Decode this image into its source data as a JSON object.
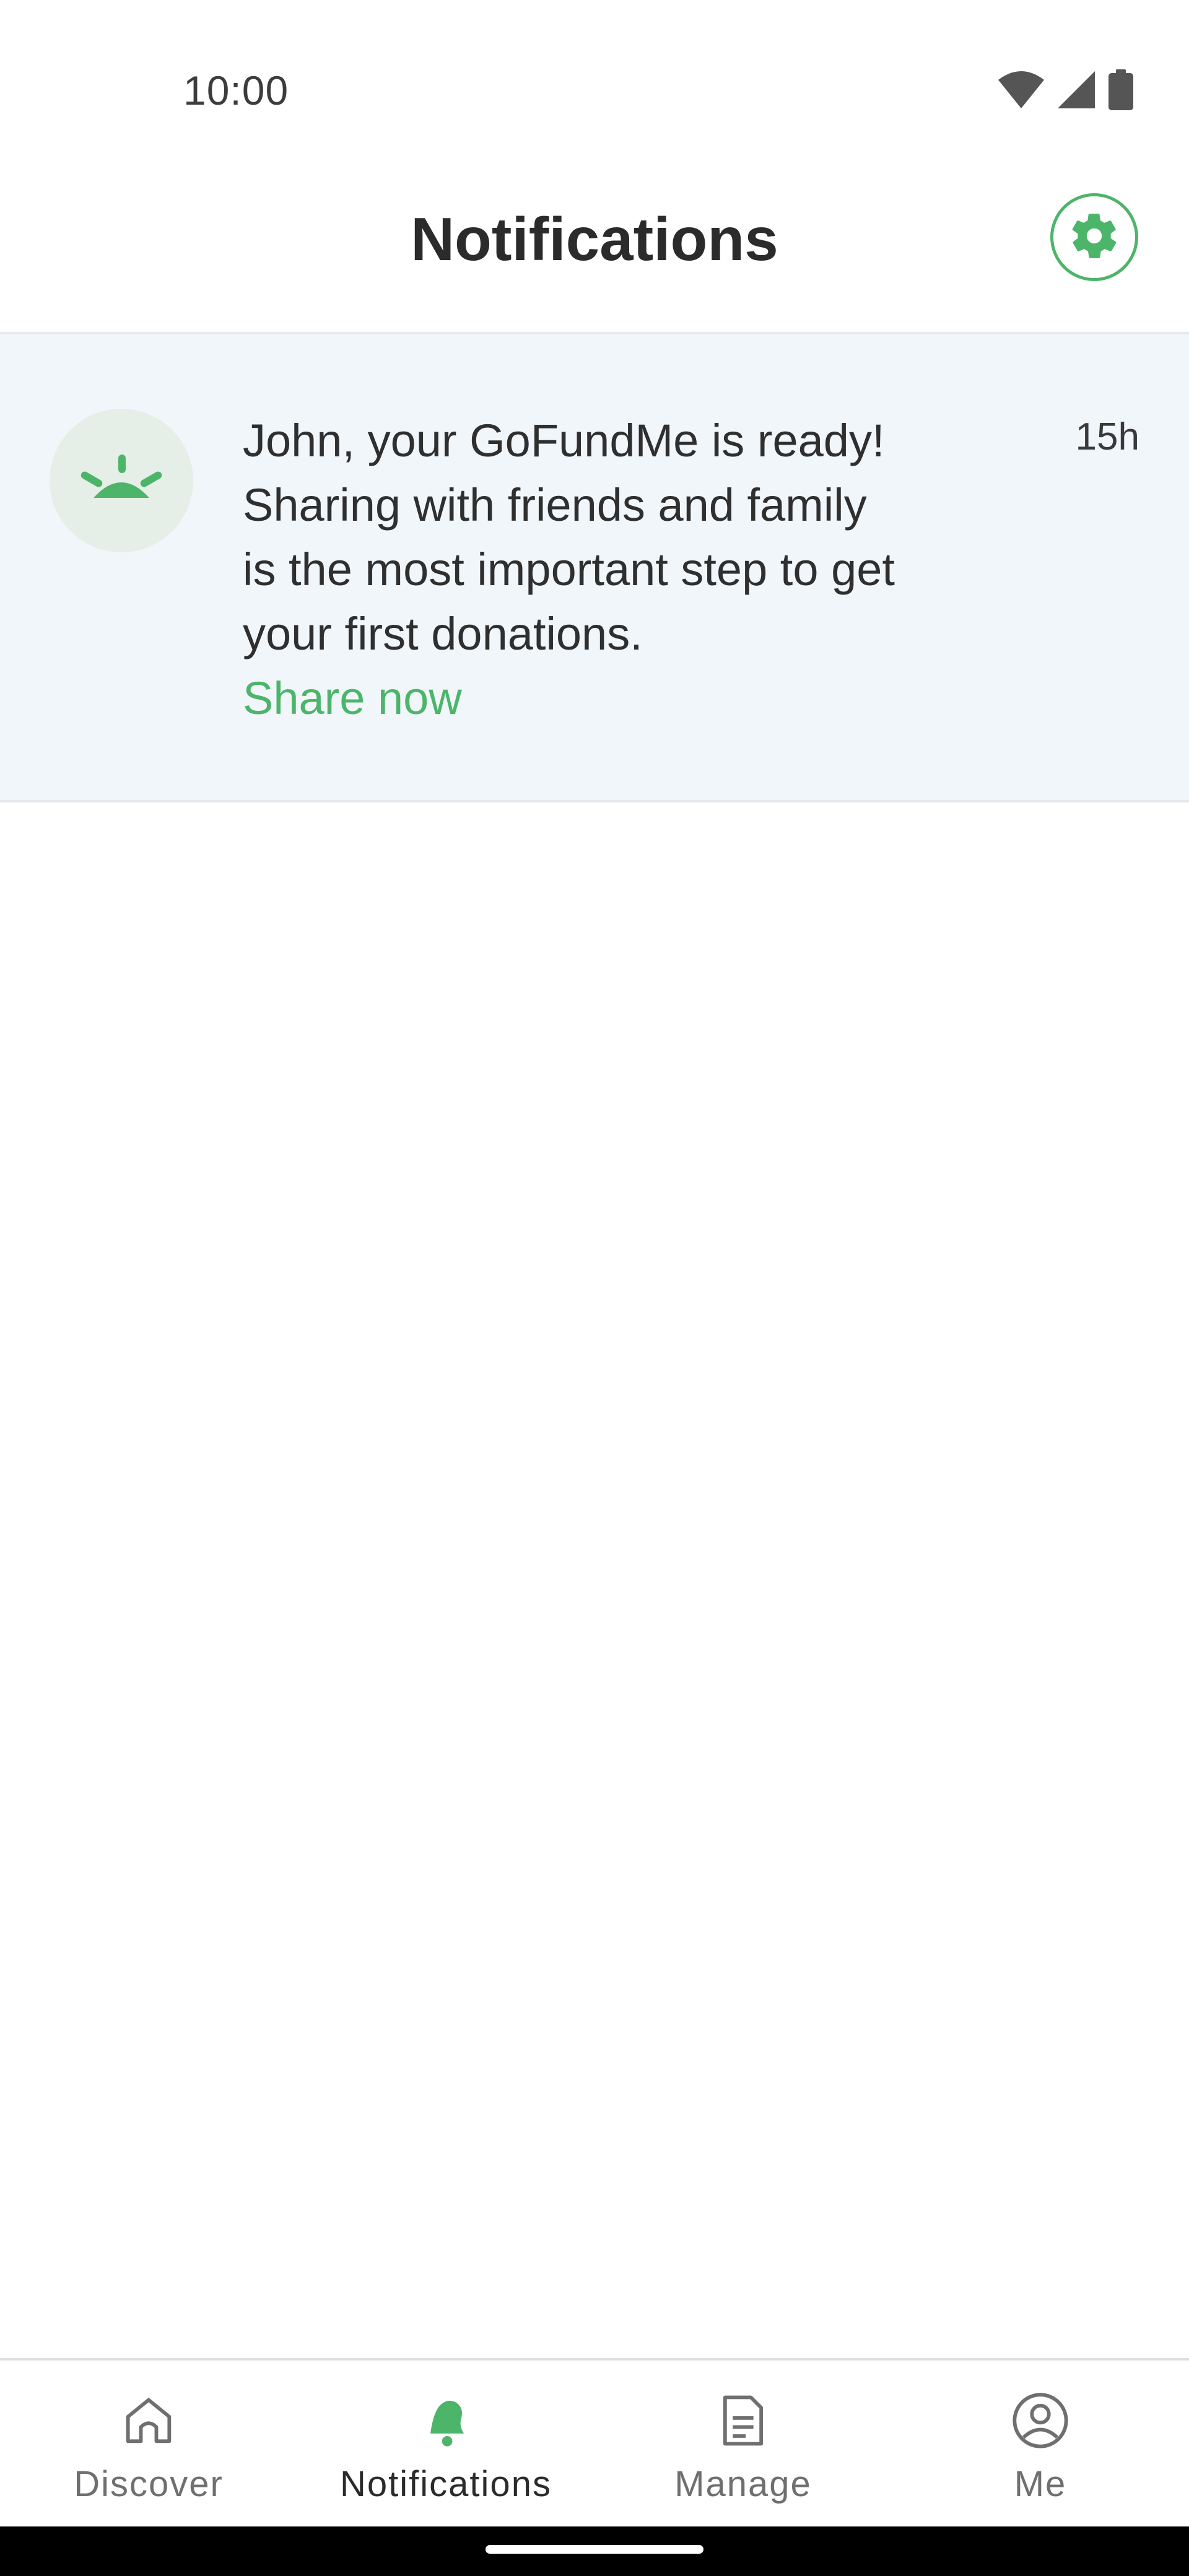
{
  "status_bar": {
    "time": "10:00",
    "icons": [
      "wifi-icon",
      "cellular-signal-icon",
      "battery-icon"
    ]
  },
  "header": {
    "title": "Notifications",
    "settings_icon": "gear-icon"
  },
  "notification": {
    "icon": "gofundme-sunrise-icon",
    "lines": [
      "John, your GoFundMe is ready!",
      "Sharing with friends and family",
      "is the most important step to get",
      "your first donations."
    ],
    "link_label": "Share now",
    "time": "15h"
  },
  "bottom_nav": {
    "items": [
      {
        "label": "Discover",
        "icon": "home-icon",
        "active": false
      },
      {
        "label": "Notifications",
        "icon": "bell-icon",
        "active": true
      },
      {
        "label": "Manage",
        "icon": "document-icon",
        "active": false
      },
      {
        "label": "Me",
        "icon": "profile-icon",
        "active": false
      }
    ]
  },
  "colors": {
    "accent": "#4cb56a",
    "notification_bg": "#f1f6fb",
    "avatar_bg": "#e5efe8",
    "text_primary": "#2b2b2b",
    "text_secondary": "#6f6f6f"
  }
}
